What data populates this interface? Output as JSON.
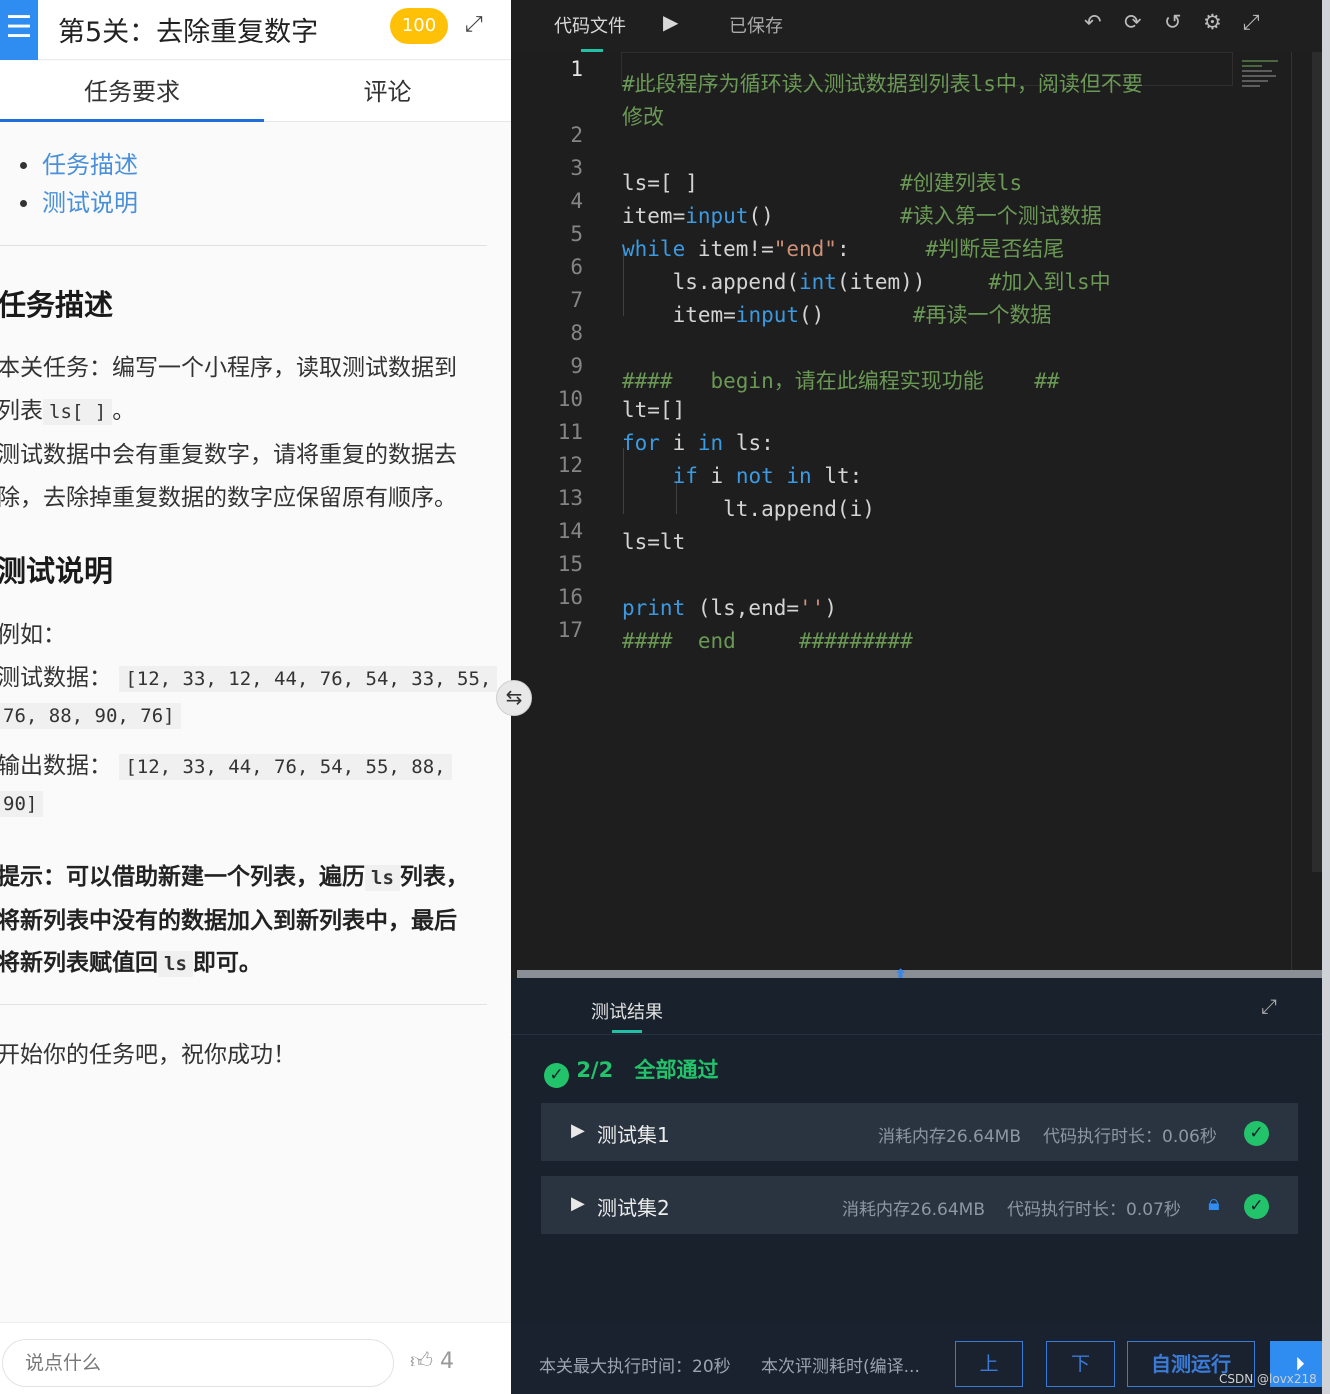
{
  "header": {
    "menu_icon": "☰",
    "level_title": "第5关：去除重复数字",
    "score": "100",
    "expand_icon": "⤢"
  },
  "tabs": [
    {
      "label": "任务要求",
      "active": true
    },
    {
      "label": "评论",
      "active": false
    }
  ],
  "toc": [
    "任务描述",
    "测试说明"
  ],
  "task": {
    "heading": "任务描述",
    "p1_a": "本关任务：编写一个小程序，读取测试数据到",
    "p1_b": "列表",
    "p1_code": "ls[ ]",
    "p1_end": "。",
    "p2_a": "测试数据中会有重复数字，请将重复的数据去",
    "p2_b": "除，去除掉重复数据的数字应保留原有顺序。"
  },
  "test": {
    "heading": "测试说明",
    "example": "例如：",
    "input_label": "测试数据：",
    "input_code_1": "[12, 33, 12, 44, 76, 54, 33, 55,",
    "input_code_2": "76, 88, 90, 76]",
    "output_label": "输出数据：",
    "output_code_1": "[12, 33, 44, 76, 54, 55, 88,",
    "output_code_2": "90]"
  },
  "hint": {
    "l1_a": "提示：可以借助新建一个列表，遍历",
    "l1_code": "ls",
    "l1_b": "列表，",
    "l2": "将新列表中没有的数据加入到新列表中，最后",
    "l3_a": "将新列表赋值回",
    "l3_code": "ls",
    "l3_b": "即可。"
  },
  "closing": "开始你的任务吧，祝你成功！",
  "comment": {
    "placeholder": "说点什么",
    "likes": "4",
    "like_icon": "thumbs-up-icon"
  },
  "editor": {
    "file_tab": "代码文件",
    "run_icon": "play-icon",
    "saved": "已保存",
    "toolbar_icons": [
      "undo-icon",
      "refresh-icon",
      "history-icon",
      "settings-icon",
      "fullscreen-icon"
    ],
    "line_numbers": [
      "1",
      "2",
      "3",
      "4",
      "5",
      "6",
      "7",
      "8",
      "9",
      "10",
      "11",
      "12",
      "13",
      "14",
      "15",
      "16",
      "17"
    ]
  },
  "results": {
    "tab": "测试结果",
    "summary_count": "2/2",
    "summary_text": "全部通过",
    "sets": [
      {
        "name": "测试集1",
        "memory": "消耗内存26.64MB",
        "time": "代码执行时长：0.06秒",
        "locked": false
      },
      {
        "name": "测试集2",
        "memory": "消耗内存26.64MB",
        "time": "代码执行时长：0.07秒",
        "locked": true
      }
    ]
  },
  "footer": {
    "max_time": "本关最大执行时间：20秒",
    "eval_time": "本次评测耗时(编译...",
    "btn_up": "上",
    "btn_down": "下",
    "btn_selftest": "自测运行",
    "watermark": "CSDN @lovx218"
  },
  "colors": {
    "accent": "#2f8cf0",
    "pass": "#23c36b",
    "badge": "#ffc107"
  }
}
